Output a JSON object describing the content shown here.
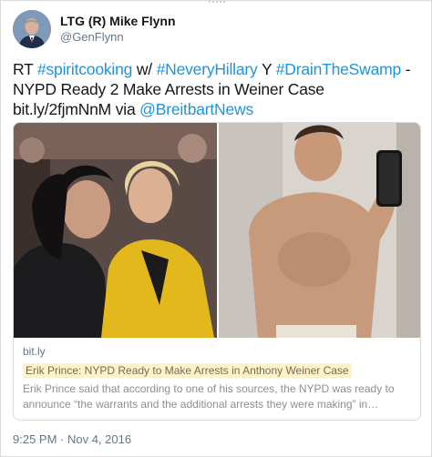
{
  "tweet": {
    "display_name": "LTG (R) Mike Flynn",
    "handle": "@GenFlynn",
    "text_parts": {
      "p1": "RT ",
      "h1": "#spiritcooking",
      "p2": " w/ ",
      "h2": "#NeveryHillary",
      "p3": " Y ",
      "h3": "#DrainTheSwamp",
      "p4": " - NYPD Ready 2 Make Arrests in Weiner Case bit.ly/2fjmNnM via ",
      "mention": "@BreitbartNews"
    },
    "timestamp": "9:25 PM · Nov 4, 2016"
  },
  "card": {
    "domain": "bit.ly",
    "title": "Erik Prince: NYPD Ready to Make Arrests in Anthony Weiner Case",
    "description": "Erik Prince said that according to one of his sources, the NYPD was ready to announce “the warrants and the additional arrests they were making” in…"
  },
  "colors": {
    "link": "#1b95e0",
    "name": "#14171a",
    "muted": "#657786",
    "highlight": "#fdf2c8"
  },
  "icons": {
    "avatar": "profile-photo",
    "card_image": "article-photo"
  }
}
